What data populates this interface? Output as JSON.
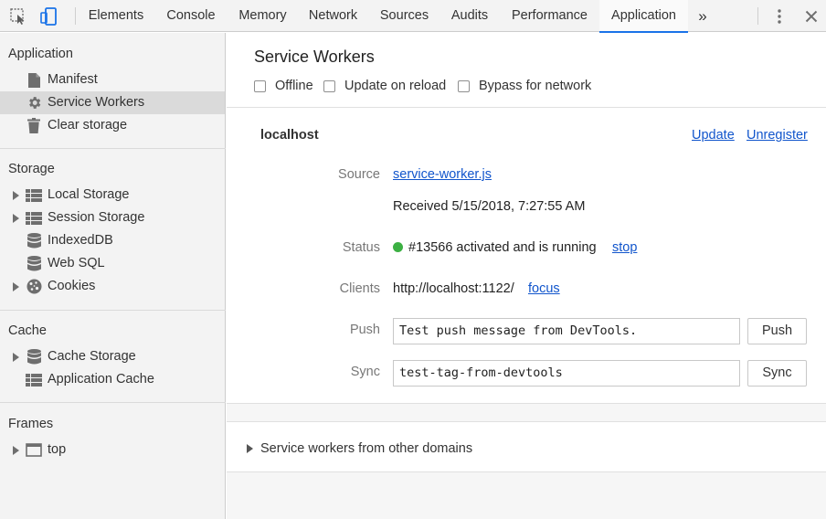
{
  "toolbar": {
    "tabs": [
      {
        "label": "Elements"
      },
      {
        "label": "Console"
      },
      {
        "label": "Memory"
      },
      {
        "label": "Network"
      },
      {
        "label": "Sources"
      },
      {
        "label": "Audits"
      },
      {
        "label": "Performance"
      },
      {
        "label": "Application"
      }
    ],
    "active_tab": "Application",
    "more_tabs_glyph": "»",
    "icons": {
      "inspect": "cursor-select-icon",
      "device": "device-toggle-icon",
      "more": "kebab-menu-icon",
      "close": "close-icon"
    },
    "accent_color": "#1a73e8"
  },
  "sidebar": {
    "sections": [
      {
        "title": "Application",
        "items": [
          {
            "label": "Manifest",
            "icon": "file-icon",
            "expandable": false,
            "selected": false
          },
          {
            "label": "Service Workers",
            "icon": "gear-icon",
            "expandable": false,
            "selected": true
          },
          {
            "label": "Clear storage",
            "icon": "trash-icon",
            "expandable": false,
            "selected": false
          }
        ]
      },
      {
        "title": "Storage",
        "items": [
          {
            "label": "Local Storage",
            "icon": "grid-icon",
            "expandable": true
          },
          {
            "label": "Session Storage",
            "icon": "grid-icon",
            "expandable": true
          },
          {
            "label": "IndexedDB",
            "icon": "database-icon",
            "expandable": false
          },
          {
            "label": "Web SQL",
            "icon": "database-icon",
            "expandable": false
          },
          {
            "label": "Cookies",
            "icon": "cookie-icon",
            "expandable": true
          }
        ]
      },
      {
        "title": "Cache",
        "items": [
          {
            "label": "Cache Storage",
            "icon": "database-icon",
            "expandable": true
          },
          {
            "label": "Application Cache",
            "icon": "grid-icon",
            "expandable": false
          }
        ]
      },
      {
        "title": "Frames",
        "items": [
          {
            "label": "top",
            "icon": "frame-icon",
            "expandable": true
          }
        ]
      }
    ]
  },
  "main": {
    "title": "Service Workers",
    "options": [
      {
        "label": "Offline",
        "checked": false
      },
      {
        "label": "Update on reload",
        "checked": false
      },
      {
        "label": "Bypass for network",
        "checked": false
      }
    ],
    "worker": {
      "origin": "localhost",
      "update_label": "Update",
      "unregister_label": "Unregister",
      "source_label": "Source",
      "source_link": "service-worker.js",
      "received": "Received 5/15/2018, 7:27:55 AM",
      "status_label": "Status",
      "status_text": "#13566 activated and is running",
      "status_color": "#3cb043",
      "stop_label": "stop",
      "clients_label": "Clients",
      "client_url": "http://localhost:1122/",
      "focus_label": "focus",
      "push_label": "Push",
      "push_value": "Test push message from DevTools.",
      "push_button": "Push",
      "sync_label": "Sync",
      "sync_value": "test-tag-from-devtools",
      "sync_button": "Sync"
    },
    "other_domains_label": "Service workers from other domains"
  }
}
